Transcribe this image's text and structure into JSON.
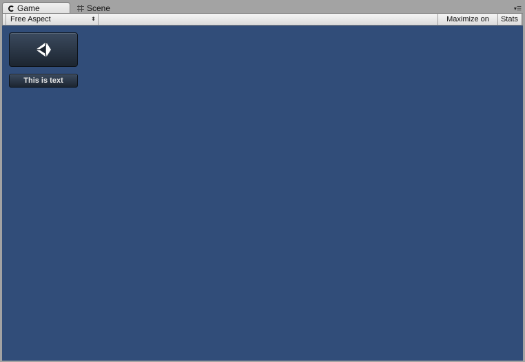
{
  "tabs": [
    {
      "label": "Game",
      "icon": "game-icon",
      "active": true
    },
    {
      "label": "Scene",
      "icon": "grid-icon",
      "active": false
    }
  ],
  "toolbar": {
    "aspect_value": "Free Aspect",
    "maximize_label": "Maximize on Play",
    "stats_label": "Stats"
  },
  "game_view": {
    "background_color": "#314d79",
    "logo_button_icon": "unity-logo-icon",
    "text_button_label": "This is text"
  }
}
